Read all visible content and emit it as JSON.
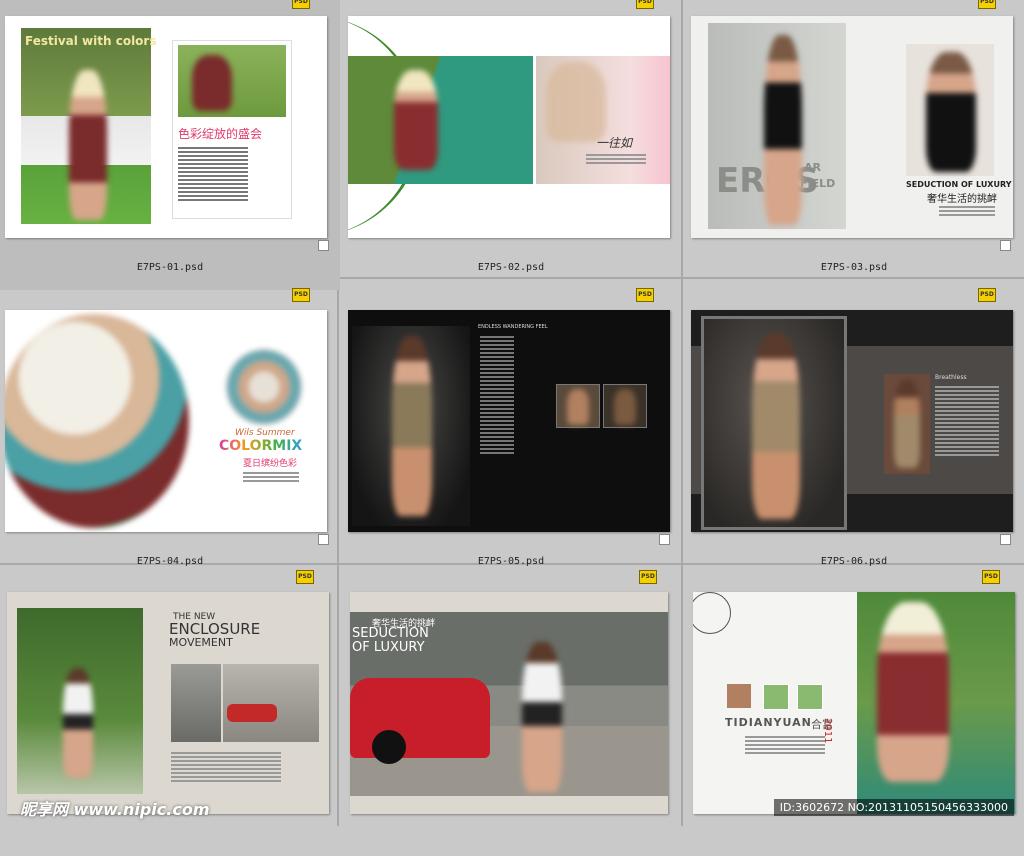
{
  "files": [
    {
      "name": "E7PS-01.psd",
      "badge": "PSD"
    },
    {
      "name": "E7PS-02.psd",
      "badge": "PSD"
    },
    {
      "name": "E7PS-03.psd",
      "badge": "PSD"
    },
    {
      "name": "E7PS-04.psd",
      "badge": "PSD"
    },
    {
      "name": "E7PS-05.psd",
      "badge": "PSD"
    },
    {
      "name": "E7PS-06.psd",
      "badge": "PSD"
    },
    {
      "name": "",
      "badge": "PSD"
    },
    {
      "name": "",
      "badge": "PSD"
    },
    {
      "name": "",
      "badge": "PSD"
    }
  ],
  "pages": {
    "p1": {
      "title": "Festival with colors",
      "heading": "色彩绽放的盛会"
    },
    "p2": {
      "script": "一往如"
    },
    "p3": {
      "big": "EROS",
      "small1": "AR",
      "small2": "FIELD",
      "en": "SEDUCTION OF LUXURY",
      "cn": "奢华生活的挑衅"
    },
    "p4": {
      "script": "Wils Summer",
      "title": "COLORMIX",
      "cn": "夏日缤纷色彩"
    },
    "p5": {
      "head": "ENDLESS  WANDERING FEEL"
    },
    "p6": {
      "head": "Breathless"
    },
    "p7": {
      "l1": "THE NEW",
      "l2": "ENCLOSURE",
      "l3": "MOVEMENT"
    },
    "p8": {
      "cn": "奢华生活的挑衅",
      "l1": "SEDUCTION",
      "l2": "OF LUXURY"
    },
    "p9": {
      "brand": "TIDIANYUAN",
      "cn": "合富",
      "year": "2011"
    }
  },
  "watermark": "昵享网 www.nipic.com",
  "id_stamp": "ID:3602672 NO:20131105150456333000",
  "colors": {
    "bg": "#c9c9c9",
    "selected": "#bdbdbd",
    "psd_badge": "#f5d000"
  }
}
